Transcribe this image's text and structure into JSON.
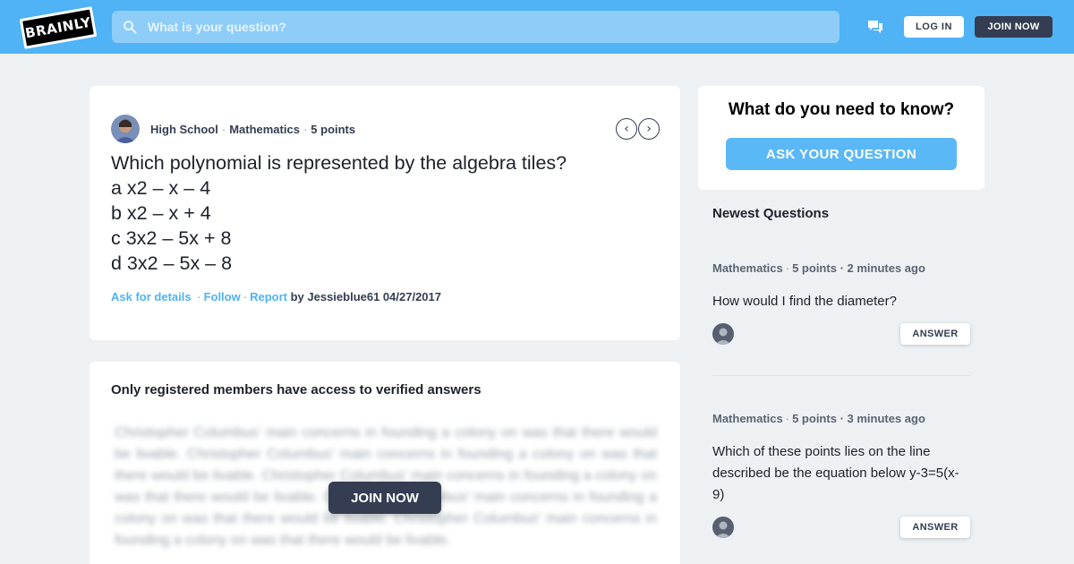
{
  "header": {
    "logo_text": "BRAINLY",
    "search_placeholder": "What is your question?",
    "login_label": "LOG IN",
    "join_label": "JOIN NOW",
    "brand_color": "#4fb3f6",
    "dark_color": "#343d51"
  },
  "question": {
    "level": "High School",
    "subject": "Mathematics",
    "points": "5 points",
    "lines": [
      "Which polynomial is represented by the algebra tiles?",
      "a x2 – x – 4",
      "b x2 – x + 4",
      "c 3x2 – 5x + 8",
      "d 3x2 – 5x – 8"
    ],
    "ask_details": "Ask for details",
    "follow": "Follow",
    "report": "Report",
    "by": "by Jessieblue61 04/27/2017"
  },
  "answer": {
    "title": "Only registered members have access to verified answers",
    "blurred_text": "Christopher Columbus' main concerns in founding a colony on was that there would be livable. Christopher Columbus' main concerns in founding a colony on was that there would be livable. Christopher Columbus' main concerns in founding a colony on was that there would be livable. Christopher Columbus' main concerns in founding a colony on was that there would be livable. Christopher Columbus' main concerns in founding a colony on was that there would be livable.",
    "join_label": "JOIN NOW"
  },
  "sidebar": {
    "ask_title": "What do you need to know?",
    "ask_button": "ASK YOUR QUESTION",
    "newest_title": "Newest Questions",
    "questions": [
      {
        "subject": "Mathematics",
        "points": "5 points",
        "time": "· 2 minutes ago",
        "text": "How would I find the diameter?",
        "answer_label": "ANSWER"
      },
      {
        "subject": "Mathematics",
        "points": "5 points",
        "time": "· 3 minutes ago",
        "text": "Which of these points lies on the line described be the equation below y-3=5(x-9)",
        "answer_label": "ANSWER"
      }
    ]
  }
}
